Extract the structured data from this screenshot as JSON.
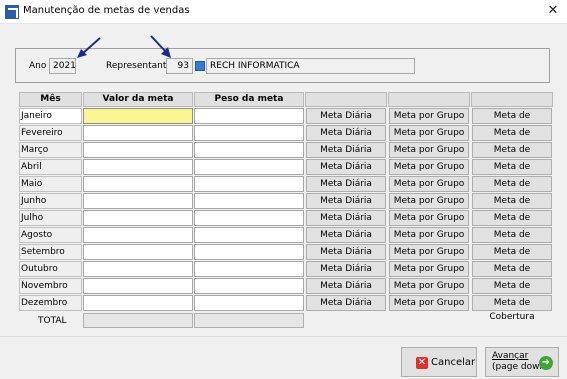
{
  "window": {
    "title": "Manutenção de metas de vendas",
    "close": "✕"
  },
  "form": {
    "ano_label": "Ano",
    "ano_value": "2021",
    "representante_label": "Representante",
    "representante_code": "93",
    "representante_name": "RECH INFORMATICA"
  },
  "table": {
    "headers": [
      "Mês",
      "Valor da meta",
      "Peso da meta"
    ],
    "months": [
      "Janeiro",
      "Fevereiro",
      "Março",
      "Abril",
      "Maio",
      "Junho",
      "Julho",
      "Agosto",
      "Setembro",
      "Outubro",
      "Novembro",
      "Dezembro"
    ],
    "btn_meta_diaria": "Meta Diária",
    "btn_meta_grupo": "Meta por Grupo",
    "btn_meta_cobertura": "Meta de Cobertura",
    "total_label": "TOTAL"
  },
  "footer": {
    "cancel_label": "Cancelar",
    "next_line1": "Avançar",
    "next_line2": "(page down)"
  },
  "icons": {
    "app": "app-icon",
    "close": "close-icon",
    "cancel": "cancel-icon",
    "next": "arrow-right-icon",
    "representante": "lookup-icon"
  },
  "colors": {
    "active_field": "#fbf693",
    "annotation_arrow": "#1a2b8c",
    "cancel_icon": "#d9342b",
    "next_icon": "#3fa535"
  }
}
